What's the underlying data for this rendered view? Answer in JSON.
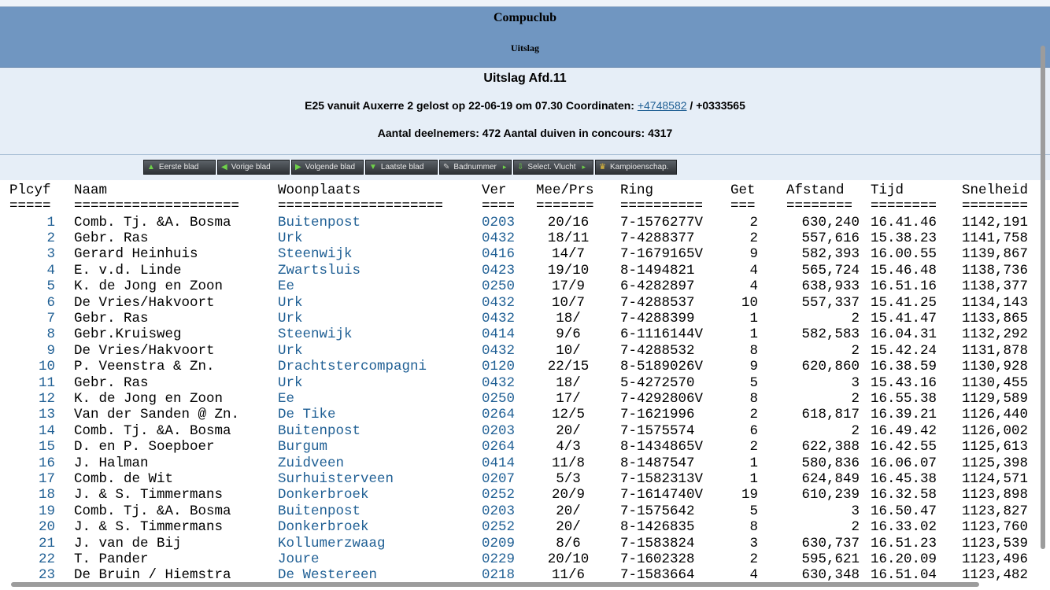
{
  "header": {
    "club": "Compuclub",
    "subtitle": "Uitslag"
  },
  "race": {
    "title": "Uitslag Afd.11",
    "description_prefix": "E25 vanuit Auxerre 2 gelost op 22-06-19 om 07.30 Coordinaten:",
    "coord_lat": "+4748582",
    "coord_sep": "/",
    "coord_lon": "+0333565",
    "participants": "Aantal deelnemers: 472 Aantal duiven in concours: 4317"
  },
  "nav": [
    {
      "label": "Eerste blad",
      "icon": "up-arrow-icon",
      "glyph": "▲"
    },
    {
      "label": "Vorige blad",
      "icon": "left-arrow-icon",
      "glyph": "◀"
    },
    {
      "label": "Volgende blad",
      "icon": "right-arrow-icon",
      "glyph": "▶"
    },
    {
      "label": "Laatste blad",
      "icon": "down-arrow-icon",
      "glyph": "▼"
    },
    {
      "label": "Badnummer",
      "icon": "wrench-icon",
      "glyph": "✎"
    },
    {
      "label": "Select. Vlucht",
      "icon": "download-icon",
      "glyph": "⇩"
    },
    {
      "label": "Kampioenschap.",
      "icon": "crown-icon",
      "glyph": "♛"
    }
  ],
  "columns": {
    "plcyf": "Plcyf",
    "naam": "Naam",
    "woonplaats": "Woonplaats",
    "ver": "Ver",
    "meeprs": "Mee/Prs",
    "ring": "Ring",
    "get": "Get",
    "afstand": "Afstand",
    "tijd": "Tijd",
    "snelheid": "Snelheid"
  },
  "separators": {
    "plcyf": "=====",
    "naam": "====================",
    "woonplaats": "====================",
    "ver": "====",
    "meeprs": "=======",
    "ring": "==========",
    "get": "===",
    "afstand": "========",
    "tijd": "========",
    "snelheid": "========"
  },
  "rows": [
    {
      "plcyf": "1",
      "naam": "Comb. Tj. &A. Bosma",
      "woonplaats": "Buitenpost",
      "ver": "0203",
      "meeprs": "20/16",
      "ring": "7-1576277V",
      "get": "2",
      "afstand": "630,240",
      "tijd": "16.41.46",
      "snelheid": "1142,191"
    },
    {
      "plcyf": "2",
      "naam": "Gebr. Ras",
      "woonplaats": "Urk",
      "ver": "0432",
      "meeprs": "18/11",
      "ring": "7-4288377",
      "get": "2",
      "afstand": "557,616",
      "tijd": "15.38.23",
      "snelheid": "1141,758"
    },
    {
      "plcyf": "3",
      "naam": "Gerard Heinhuis",
      "woonplaats": "Steenwijk",
      "ver": "0416",
      "meeprs": "14/7",
      "ring": "7-1679165V",
      "get": "9",
      "afstand": "582,393",
      "tijd": "16.00.55",
      "snelheid": "1139,867"
    },
    {
      "plcyf": "4",
      "naam": "E. v.d. Linde",
      "woonplaats": "Zwartsluis",
      "ver": "0423",
      "meeprs": "19/10",
      "ring": "8-1494821",
      "get": "4",
      "afstand": "565,724",
      "tijd": "15.46.48",
      "snelheid": "1138,736"
    },
    {
      "plcyf": "5",
      "naam": "K. de Jong en Zoon",
      "woonplaats": "Ee",
      "ver": "0250",
      "meeprs": "17/9",
      "ring": "6-4282897",
      "get": "4",
      "afstand": "638,933",
      "tijd": "16.51.16",
      "snelheid": "1138,377"
    },
    {
      "plcyf": "6",
      "naam": "De Vries/Hakvoort",
      "woonplaats": "Urk",
      "ver": "0432",
      "meeprs": "10/7",
      "ring": "7-4288537",
      "get": "10",
      "afstand": "557,337",
      "tijd": "15.41.25",
      "snelheid": "1134,143"
    },
    {
      "plcyf": "7",
      "naam": "Gebr. Ras",
      "woonplaats": "Urk",
      "ver": "0432",
      "meeprs": "18/",
      "ring": "7-4288399",
      "get": "1",
      "afstand": "2",
      "tijd": "15.41.47",
      "snelheid": "1133,865"
    },
    {
      "plcyf": "8",
      "naam": "Gebr.Kruisweg",
      "woonplaats": "Steenwijk",
      "ver": "0414",
      "meeprs": "9/6",
      "ring": "6-1116144V",
      "get": "1",
      "afstand": "582,583",
      "tijd": "16.04.31",
      "snelheid": "1132,292"
    },
    {
      "plcyf": "9",
      "naam": "De Vries/Hakvoort",
      "woonplaats": "Urk",
      "ver": "0432",
      "meeprs": "10/",
      "ring": "7-4288532",
      "get": "8",
      "afstand": "2",
      "tijd": "15.42.24",
      "snelheid": "1131,878"
    },
    {
      "plcyf": "10",
      "naam": "P. Veenstra & Zn.",
      "woonplaats": "Drachtstercompagni",
      "ver": "0120",
      "meeprs": "22/15",
      "ring": "8-5189026V",
      "get": "9",
      "afstand": "620,860",
      "tijd": "16.38.59",
      "snelheid": "1130,928"
    },
    {
      "plcyf": "11",
      "naam": "Gebr. Ras",
      "woonplaats": "Urk",
      "ver": "0432",
      "meeprs": "18/",
      "ring": "5-4272570",
      "get": "5",
      "afstand": "3",
      "tijd": "15.43.16",
      "snelheid": "1130,455"
    },
    {
      "plcyf": "12",
      "naam": "K. de Jong en Zoon",
      "woonplaats": "Ee",
      "ver": "0250",
      "meeprs": "17/",
      "ring": "7-4292806V",
      "get": "8",
      "afstand": "2",
      "tijd": "16.55.38",
      "snelheid": "1129,589"
    },
    {
      "plcyf": "13",
      "naam": "Van der Sanden @ Zn.",
      "woonplaats": "De Tike",
      "ver": "0264",
      "meeprs": "12/5",
      "ring": "7-1621996",
      "get": "2",
      "afstand": "618,817",
      "tijd": "16.39.21",
      "snelheid": "1126,440"
    },
    {
      "plcyf": "14",
      "naam": "Comb. Tj. &A. Bosma",
      "woonplaats": "Buitenpost",
      "ver": "0203",
      "meeprs": "20/",
      "ring": "7-1575574",
      "get": "6",
      "afstand": "2",
      "tijd": "16.49.42",
      "snelheid": "1126,002"
    },
    {
      "plcyf": "15",
      "naam": "D. en P. Soepboer",
      "woonplaats": "Burgum",
      "ver": "0264",
      "meeprs": "4/3",
      "ring": "8-1434865V",
      "get": "2",
      "afstand": "622,388",
      "tijd": "16.42.55",
      "snelheid": "1125,613"
    },
    {
      "plcyf": "16",
      "naam": "J. Halman",
      "woonplaats": "Zuidveen",
      "ver": "0414",
      "meeprs": "11/8",
      "ring": "8-1487547",
      "get": "1",
      "afstand": "580,836",
      "tijd": "16.06.07",
      "snelheid": "1125,398"
    },
    {
      "plcyf": "17",
      "naam": "Comb. de Wit",
      "woonplaats": "Surhuisterveen",
      "ver": "0207",
      "meeprs": "5/3",
      "ring": "7-1582313V",
      "get": "1",
      "afstand": "624,849",
      "tijd": "16.45.38",
      "snelheid": "1124,571"
    },
    {
      "plcyf": "18",
      "naam": "J. & S. Timmermans",
      "woonplaats": "Donkerbroek",
      "ver": "0252",
      "meeprs": "20/9",
      "ring": "7-1614740V",
      "get": "19",
      "afstand": "610,239",
      "tijd": "16.32.58",
      "snelheid": "1123,898"
    },
    {
      "plcyf": "19",
      "naam": "Comb. Tj. &A. Bosma",
      "woonplaats": "Buitenpost",
      "ver": "0203",
      "meeprs": "20/",
      "ring": "7-1575642",
      "get": "5",
      "afstand": "3",
      "tijd": "16.50.47",
      "snelheid": "1123,827"
    },
    {
      "plcyf": "20",
      "naam": "J. & S. Timmermans",
      "woonplaats": "Donkerbroek",
      "ver": "0252",
      "meeprs": "20/",
      "ring": "8-1426835",
      "get": "8",
      "afstand": "2",
      "tijd": "16.33.02",
      "snelheid": "1123,760"
    },
    {
      "plcyf": "21",
      "naam": "J. van de Bij",
      "woonplaats": "Kollumerzwaag",
      "ver": "0209",
      "meeprs": "8/6",
      "ring": "7-1583824",
      "get": "3",
      "afstand": "630,737",
      "tijd": "16.51.23",
      "snelheid": "1123,539"
    },
    {
      "plcyf": "22",
      "naam": "T. Pander",
      "woonplaats": "Joure",
      "ver": "0229",
      "meeprs": "20/10",
      "ring": "7-1602328",
      "get": "2",
      "afstand": "595,621",
      "tijd": "16.20.09",
      "snelheid": "1123,496"
    },
    {
      "plcyf": "23",
      "naam": "De Bruin / Hiemstra",
      "woonplaats": "De Westereen",
      "ver": "0218",
      "meeprs": "11/6",
      "ring": "7-1583664",
      "get": "4",
      "afstand": "630,348",
      "tijd": "16.51.04",
      "snelheid": "1123,482"
    }
  ]
}
